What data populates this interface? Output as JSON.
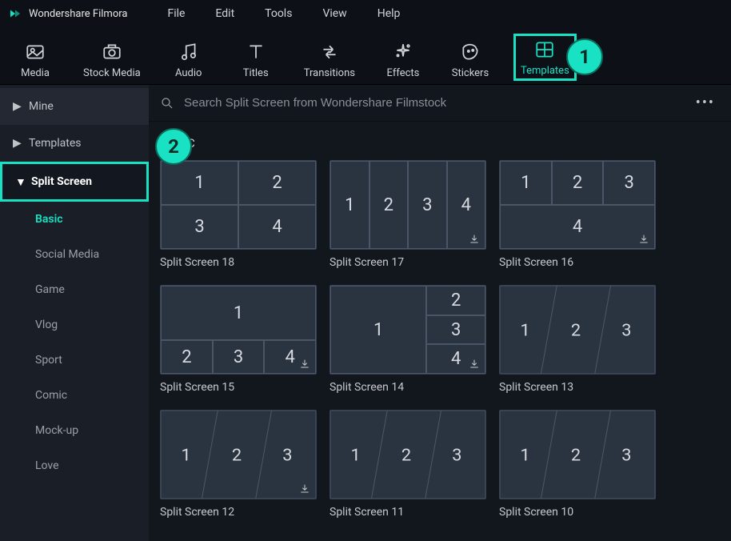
{
  "app": {
    "name": "Wondershare Filmora"
  },
  "menus": [
    "File",
    "Edit",
    "Tools",
    "View",
    "Help"
  ],
  "toolbar": [
    {
      "id": "media",
      "label": "Media",
      "icon": "image"
    },
    {
      "id": "stock-media",
      "label": "Stock Media",
      "icon": "camera"
    },
    {
      "id": "audio",
      "label": "Audio",
      "icon": "note"
    },
    {
      "id": "titles",
      "label": "Titles",
      "icon": "T"
    },
    {
      "id": "transitions",
      "label": "Transitions",
      "icon": "swap"
    },
    {
      "id": "effects",
      "label": "Effects",
      "icon": "sparkle"
    },
    {
      "id": "stickers",
      "label": "Stickers",
      "icon": "sticker"
    },
    {
      "id": "templates",
      "label": "Templates",
      "icon": "grid",
      "active": true
    }
  ],
  "annotations": {
    "badge1": "1",
    "badge2": "2"
  },
  "sidebar": {
    "groups": [
      {
        "id": "mine",
        "label": "Mine",
        "expanded": false
      },
      {
        "id": "templates",
        "label": "Templates",
        "expanded": false
      },
      {
        "id": "split",
        "label": "Split Screen",
        "expanded": true,
        "highlight": true,
        "items": [
          {
            "id": "basic",
            "label": "Basic",
            "active": true
          },
          {
            "id": "socialmedia",
            "label": "Social Media"
          },
          {
            "id": "game",
            "label": "Game"
          },
          {
            "id": "vlog",
            "label": "Vlog"
          },
          {
            "id": "sport",
            "label": "Sport"
          },
          {
            "id": "comic",
            "label": "Comic"
          },
          {
            "id": "mockup",
            "label": "Mock-up"
          },
          {
            "id": "love",
            "label": "Love"
          }
        ]
      }
    ]
  },
  "search": {
    "placeholder": "Search Split Screen from Wondershare Filmstock"
  },
  "section": {
    "label": "C"
  },
  "templates": [
    {
      "id": "ss18",
      "name": "Split Screen 18",
      "layout": "grid2x2",
      "download": false
    },
    {
      "id": "ss17",
      "name": "Split Screen 17",
      "layout": "row4",
      "download": true
    },
    {
      "id": "ss16",
      "name": "Split Screen 16",
      "layout": "row3top1bot",
      "download": true
    },
    {
      "id": "ss15",
      "name": "Split Screen 15",
      "layout": "big1row3",
      "download": true
    },
    {
      "id": "ss14",
      "name": "Split Screen 14",
      "layout": "left1col3",
      "download": true
    },
    {
      "id": "ss13",
      "name": "Split Screen 13",
      "layout": "diag3",
      "download": false
    },
    {
      "id": "ss12",
      "name": "Split Screen 12",
      "layout": "diag3",
      "download": true
    },
    {
      "id": "ss11",
      "name": "Split Screen 11",
      "layout": "diag3",
      "download": false
    },
    {
      "id": "ss10",
      "name": "Split Screen 10",
      "layout": "diag3",
      "download": false
    }
  ]
}
